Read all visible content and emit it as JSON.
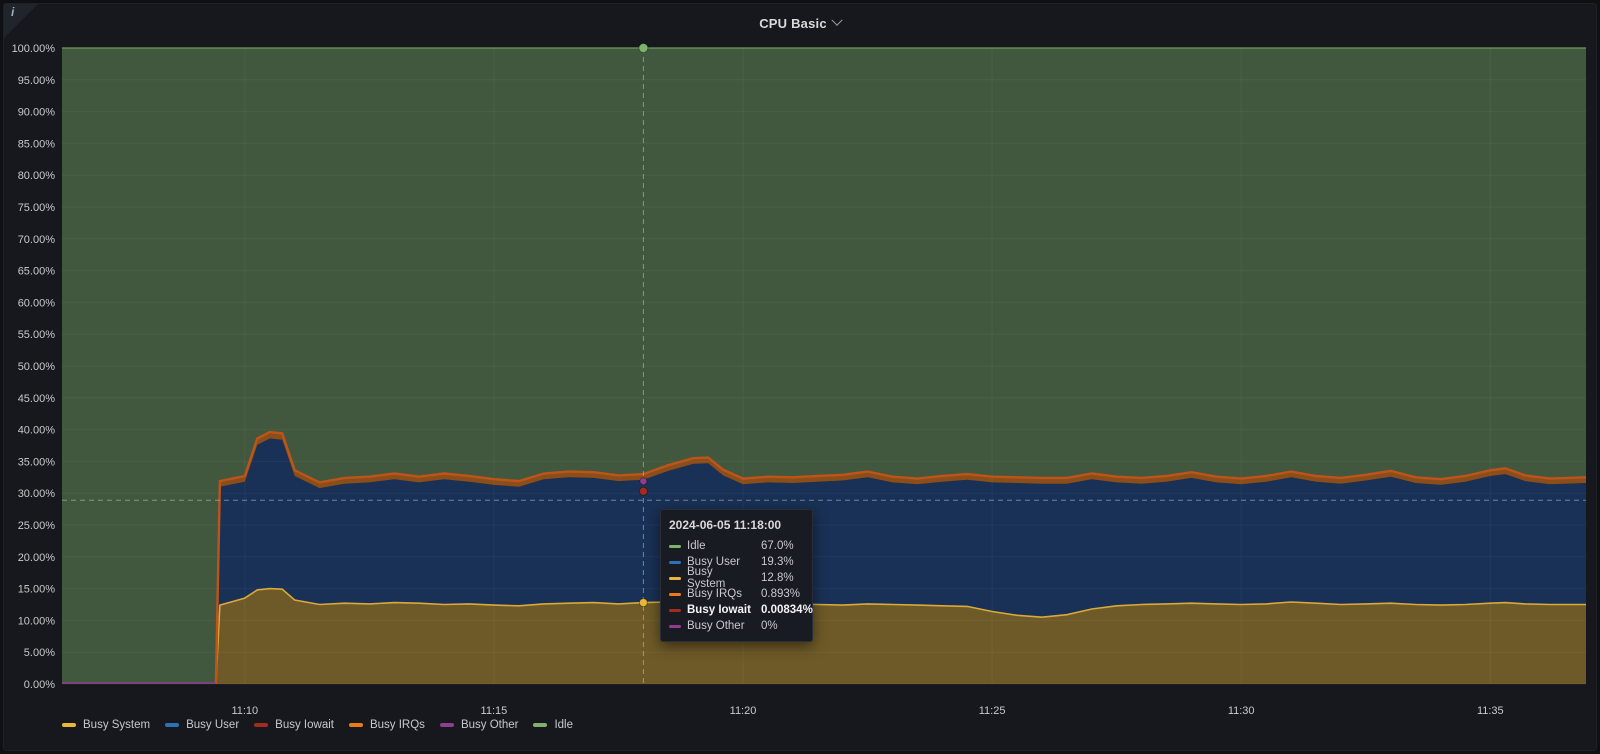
{
  "panel": {
    "title": "CPU Basic",
    "info_icon": "i"
  },
  "colors": {
    "page_bg": "#0e1014",
    "panel_bg": "#16181d",
    "grid": "rgba(204,204,220,0.07)",
    "axis_text": "#c8c9cc",
    "crosshair": "rgba(180,200,220,0.55)"
  },
  "chart_data": {
    "type": "area",
    "stacked": true,
    "unit": "percent",
    "title": "CPU Basic",
    "ylim": [
      0,
      100
    ],
    "grid": true,
    "legend_position": "bottom-left",
    "y_tick_labels": [
      "0.00%",
      "5.00%",
      "10.00%",
      "15.00%",
      "20.00%",
      "25.00%",
      "30.00%",
      "35.00%",
      "40.00%",
      "45.00%",
      "50.00%",
      "55.00%",
      "60.00%",
      "65.00%",
      "70.00%",
      "75.00%",
      "80.00%",
      "85.00%",
      "90.00%",
      "95.00%",
      "100.00%"
    ],
    "x_ticks": [
      {
        "t": 10,
        "label": "11:10"
      },
      {
        "t": 15,
        "label": "11:15"
      },
      {
        "t": 20,
        "label": "11:20"
      },
      {
        "t": 25,
        "label": "11:25"
      },
      {
        "t": 30,
        "label": "11:30"
      },
      {
        "t": 35,
        "label": "11:35"
      }
    ],
    "x_domain_minutes": [
      6.33,
      36.92
    ],
    "pre_data": {
      "end_minutes": 9.42,
      "zero_line_color": "#8F3D8F"
    },
    "t": [
      6.33,
      9.42,
      9.5,
      10.0,
      10.25,
      10.5,
      10.75,
      11.0,
      11.5,
      12.0,
      12.5,
      13.0,
      13.5,
      14.0,
      14.5,
      15.0,
      15.5,
      16.0,
      16.5,
      17.0,
      17.5,
      18.0,
      18.5,
      19.0,
      19.3,
      19.6,
      20.0,
      20.5,
      21.0,
      21.5,
      22.0,
      22.5,
      23.0,
      23.5,
      24.0,
      24.5,
      25.0,
      25.5,
      26.0,
      26.5,
      27.0,
      27.5,
      28.0,
      28.5,
      29.0,
      29.5,
      30.0,
      30.5,
      31.0,
      31.5,
      32.0,
      32.5,
      33.0,
      33.5,
      34.0,
      34.5,
      35.0,
      35.3,
      35.7,
      36.2,
      36.92
    ],
    "series": [
      {
        "name": "Busy System",
        "color": "#EAB839",
        "fill": "rgba(234,184,57,0.42)",
        "line": "#D9A93A",
        "values": [
          0,
          0,
          12.4,
          13.5,
          14.8,
          15.0,
          14.9,
          13.2,
          12.5,
          12.7,
          12.6,
          12.8,
          12.7,
          12.5,
          12.6,
          12.4,
          12.3,
          12.6,
          12.7,
          12.8,
          12.6,
          12.8,
          12.9,
          13.0,
          12.9,
          12.7,
          12.4,
          12.5,
          12.6,
          12.5,
          12.4,
          12.6,
          12.5,
          12.4,
          12.3,
          12.2,
          11.4,
          10.8,
          10.5,
          10.9,
          11.8,
          12.3,
          12.5,
          12.6,
          12.7,
          12.6,
          12.5,
          12.6,
          12.9,
          12.7,
          12.5,
          12.6,
          12.7,
          12.5,
          12.4,
          12.5,
          12.7,
          12.8,
          12.6,
          12.5,
          12.5
        ]
      },
      {
        "name": "Busy User",
        "color": "#2B72B8",
        "fill": "rgba(31,96,196,0.35)",
        "line": "none",
        "values": [
          0,
          0,
          18.6,
          18.3,
          22.8,
          23.6,
          23.5,
          19.5,
          18.3,
          18.8,
          19.1,
          19.4,
          19.0,
          19.7,
          19.2,
          18.9,
          18.7,
          19.6,
          19.8,
          19.6,
          19.3,
          19.3,
          20.6,
          21.6,
          21.8,
          20.1,
          19.0,
          19.2,
          19.0,
          19.3,
          19.6,
          19.9,
          19.2,
          19.0,
          19.5,
          19.9,
          20.3,
          20.8,
          21.0,
          20.6,
          20.4,
          19.4,
          19.0,
          19.2,
          19.7,
          19.1,
          18.9,
          19.2,
          19.6,
          19.1,
          19.0,
          19.4,
          19.9,
          19.1,
          18.9,
          19.3,
          20.0,
          20.2,
          19.3,
          18.9,
          19.1
        ]
      },
      {
        "name": "Busy IRQs",
        "color": "#EB7B18",
        "fill": "rgba(235,123,24,0.55)",
        "line": "#BE5419",
        "values": [
          0,
          0,
          0.9,
          0.9,
          1.0,
          1.0,
          1.0,
          0.9,
          0.9,
          0.9,
          0.9,
          0.9,
          0.9,
          0.9,
          0.9,
          0.9,
          0.9,
          0.9,
          0.9,
          0.9,
          0.9,
          0.9,
          0.9,
          0.9,
          0.9,
          0.9,
          0.9,
          0.9,
          0.9,
          0.9,
          0.9,
          0.9,
          0.9,
          0.9,
          0.9,
          0.9,
          0.9,
          0.9,
          0.9,
          0.9,
          0.9,
          0.9,
          0.9,
          0.9,
          0.9,
          0.9,
          0.9,
          0.9,
          0.9,
          0.9,
          0.9,
          0.9,
          0.9,
          0.9,
          0.9,
          0.9,
          0.9,
          0.9,
          0.9,
          0.9,
          0.9
        ]
      },
      {
        "name": "Busy Iowait",
        "color": "#A22C1E",
        "values_constant": 0
      },
      {
        "name": "Busy Other",
        "color": "#8F3D8F",
        "values_constant": 0
      },
      {
        "name": "Idle",
        "color": "#7EB26D",
        "fill": "rgba(126,178,109,0.42)",
        "line": "#6d9a60",
        "fill_mode": "to_100"
      }
    ]
  },
  "legend": {
    "items": [
      {
        "label": "Busy System",
        "color": "#EAB839"
      },
      {
        "label": "Busy User",
        "color": "#2B72B8"
      },
      {
        "label": "Busy Iowait",
        "color": "#A22C1E"
      },
      {
        "label": "Busy IRQs",
        "color": "#EB7B18"
      },
      {
        "label": "Busy Other",
        "color": "#8F3D8F"
      },
      {
        "label": "Idle",
        "color": "#7EB26D"
      }
    ]
  },
  "tooltip": {
    "title": "2024-06-05 11:18:00",
    "rows": [
      {
        "series": "Idle",
        "color": "#7EB26D",
        "value": "67.0%",
        "bold": false
      },
      {
        "series": "Busy User",
        "color": "#2B72B8",
        "value": "19.3%",
        "bold": false
      },
      {
        "series": "Busy System",
        "color": "#EAB839",
        "value": "12.8%",
        "bold": false
      },
      {
        "series": "Busy IRQs",
        "color": "#EB7B18",
        "value": "0.893%",
        "bold": false
      },
      {
        "series": "Busy Iowait",
        "color": "#A22C1E",
        "value": "0.00834%",
        "bold": true
      },
      {
        "series": "Busy Other",
        "color": "#8F3D8F",
        "value": "0%",
        "bold": false
      }
    ]
  },
  "crosshair": {
    "time_minutes": 18,
    "cursor_value": 28.9,
    "points": [
      {
        "series": "Idle",
        "color": "#7EB26D",
        "value": 100,
        "r": 4.5
      },
      {
        "series": "Busy Other",
        "color": "#8F3D8F",
        "value": 31.9,
        "r": 3.5
      },
      {
        "series": "Busy Iowait",
        "color": "#A22C1E",
        "value": 30.3,
        "r": 4
      },
      {
        "series": "Busy System",
        "color": "#EAB839",
        "value": 12.8,
        "r": 4
      }
    ]
  }
}
